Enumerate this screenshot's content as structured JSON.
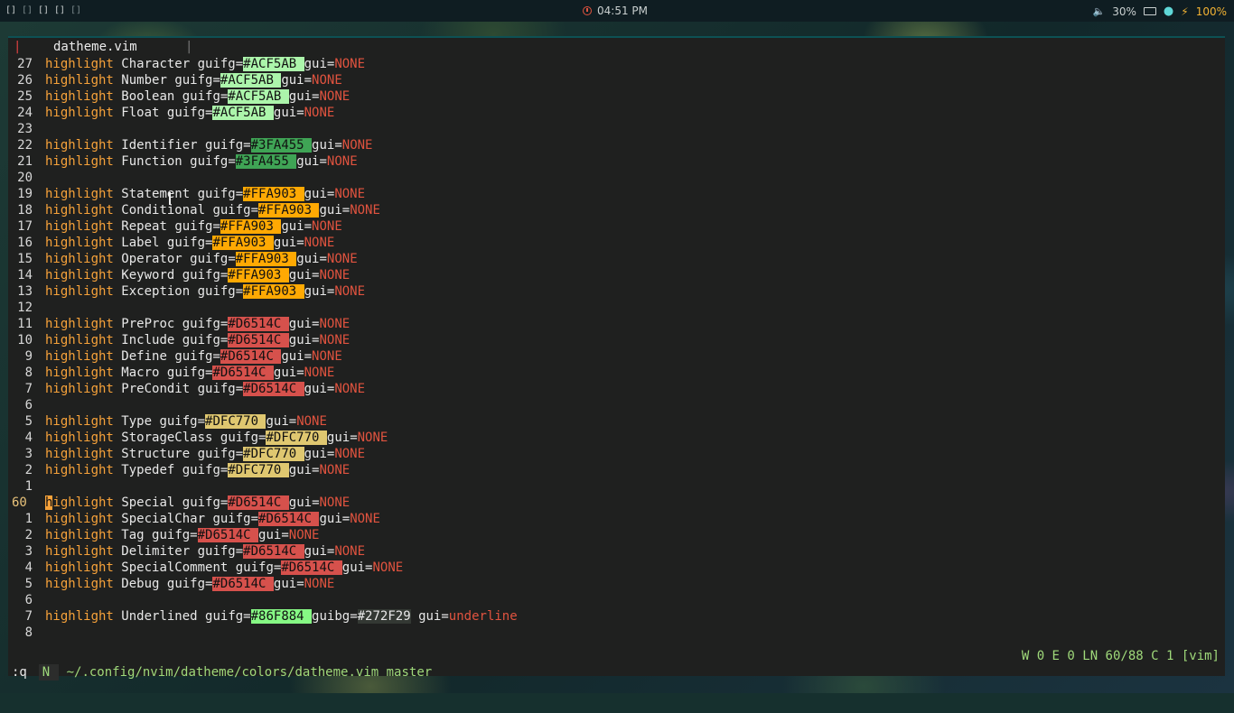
{
  "topbar": {
    "workspaces": [
      "[]",
      "[]",
      "[]",
      "[]",
      "[]"
    ],
    "clock": "04:51 PM",
    "volume": "30%",
    "battery": "100%"
  },
  "colors": {
    "keyword": "#F7A23A",
    "none": "#E0533F",
    "statusline": "#9FD97A"
  },
  "tab": {
    "name": "datheme.vim",
    "separator": "|",
    "left_mark": "|"
  },
  "buffer": [
    {
      "num": "27",
      "name": "Character",
      "hex": "#ACF5AB",
      "bg": "#ACF5AB",
      "pad": " "
    },
    {
      "num": "26",
      "name": "Number",
      "hex": "#ACF5AB",
      "bg": "#ACF5AB",
      "pad": " "
    },
    {
      "num": "25",
      "name": "Boolean",
      "hex": "#ACF5AB",
      "bg": "#ACF5AB",
      "pad": " "
    },
    {
      "num": "24",
      "name": "Float",
      "hex": "#ACF5AB",
      "bg": "#ACF5AB",
      "pad": " "
    },
    {
      "num": "23",
      "blank": true
    },
    {
      "num": "22",
      "name": "Identifier",
      "hex": "#3FA455",
      "bg": "#3FA455",
      "pad": " "
    },
    {
      "num": "21",
      "name": "Function",
      "hex": "#3FA455",
      "bg": "#3FA455",
      "pad": " "
    },
    {
      "num": "20",
      "blank": true
    },
    {
      "num": "19",
      "name": "Statement",
      "hex": "#FFA903",
      "bg": "#FFA903",
      "pad": " "
    },
    {
      "num": "18",
      "name": "Conditional",
      "hex": "#FFA903",
      "bg": "#FFA903",
      "pad": " "
    },
    {
      "num": "17",
      "name": "Repeat",
      "hex": "#FFA903",
      "bg": "#FFA903",
      "pad": " "
    },
    {
      "num": "16",
      "name": "Label",
      "hex": "#FFA903",
      "bg": "#FFA903",
      "pad": " "
    },
    {
      "num": "15",
      "name": "Operator",
      "hex": "#FFA903",
      "bg": "#FFA903",
      "pad": " "
    },
    {
      "num": "14",
      "name": "Keyword",
      "hex": "#FFA903",
      "bg": "#FFA903",
      "pad": " "
    },
    {
      "num": "13",
      "name": "Exception",
      "hex": "#FFA903",
      "bg": "#FFA903",
      "pad": " "
    },
    {
      "num": "12",
      "blank": true
    },
    {
      "num": "11",
      "name": "PreProc",
      "hex": "#D6514C",
      "bg": "#D6514C",
      "pad": " "
    },
    {
      "num": "10",
      "name": "Include",
      "hex": "#D6514C",
      "bg": "#D6514C",
      "pad": " "
    },
    {
      "num": "9",
      "name": "Define",
      "hex": "#D6514C",
      "bg": "#D6514C",
      "pad": " "
    },
    {
      "num": "8",
      "name": "Macro",
      "hex": "#D6514C",
      "bg": "#D6514C",
      "pad": " "
    },
    {
      "num": "7",
      "name": "PreCondit",
      "hex": "#D6514C",
      "bg": "#D6514C",
      "pad": " "
    },
    {
      "num": "6",
      "blank": true
    },
    {
      "num": "5",
      "name": "Type",
      "hex": "#DFC770",
      "bg": "#DFC770",
      "pad": " "
    },
    {
      "num": "4",
      "name": "StorageClass",
      "hex": "#DFC770",
      "bg": "#DFC770",
      "pad": " "
    },
    {
      "num": "3",
      "name": "Structure",
      "hex": "#DFC770",
      "bg": "#DFC770",
      "pad": " "
    },
    {
      "num": "2",
      "name": "Typedef",
      "hex": "#DFC770",
      "bg": "#DFC770",
      "pad": " "
    },
    {
      "num": "1",
      "blank": true
    },
    {
      "num": "60",
      "name": "Special",
      "hex": "#D6514C",
      "bg": "#D6514C",
      "pad": " ",
      "current": true
    },
    {
      "num": "1",
      "name": "SpecialChar",
      "hex": "#D6514C",
      "bg": "#D6514C",
      "pad": " "
    },
    {
      "num": "2",
      "name": "Tag",
      "hex": "#D6514C",
      "bg": "#D6514C",
      "pad": " "
    },
    {
      "num": "3",
      "name": "Delimiter",
      "hex": "#D6514C",
      "bg": "#D6514C",
      "pad": " "
    },
    {
      "num": "4",
      "name": "SpecialComment",
      "hex": "#D6514C",
      "bg": "#D6514C",
      "pad": " "
    },
    {
      "num": "5",
      "name": "Debug",
      "hex": "#D6514C",
      "bg": "#D6514C",
      "pad": " "
    },
    {
      "num": "6",
      "blank": true
    },
    {
      "num": "7",
      "name": "Underlined",
      "hex": "#86F884",
      "bg": "#86F884",
      "pad": " ",
      "guibg": "#272F29",
      "gui": "underline"
    },
    {
      "num": "8",
      "blank": true
    }
  ],
  "words": {
    "highlight": "highlight",
    "guifg": "guifg=",
    "guibg": "guibg=",
    "gui": "gui=",
    "none": "NONE"
  },
  "status": {
    "mode": "N",
    "path": "~/.config/nvim/datheme/colors/datheme.vim master",
    "right": "W 0 E 0 LN 60/88 C 1 [vim]"
  },
  "cmdline": ":q"
}
